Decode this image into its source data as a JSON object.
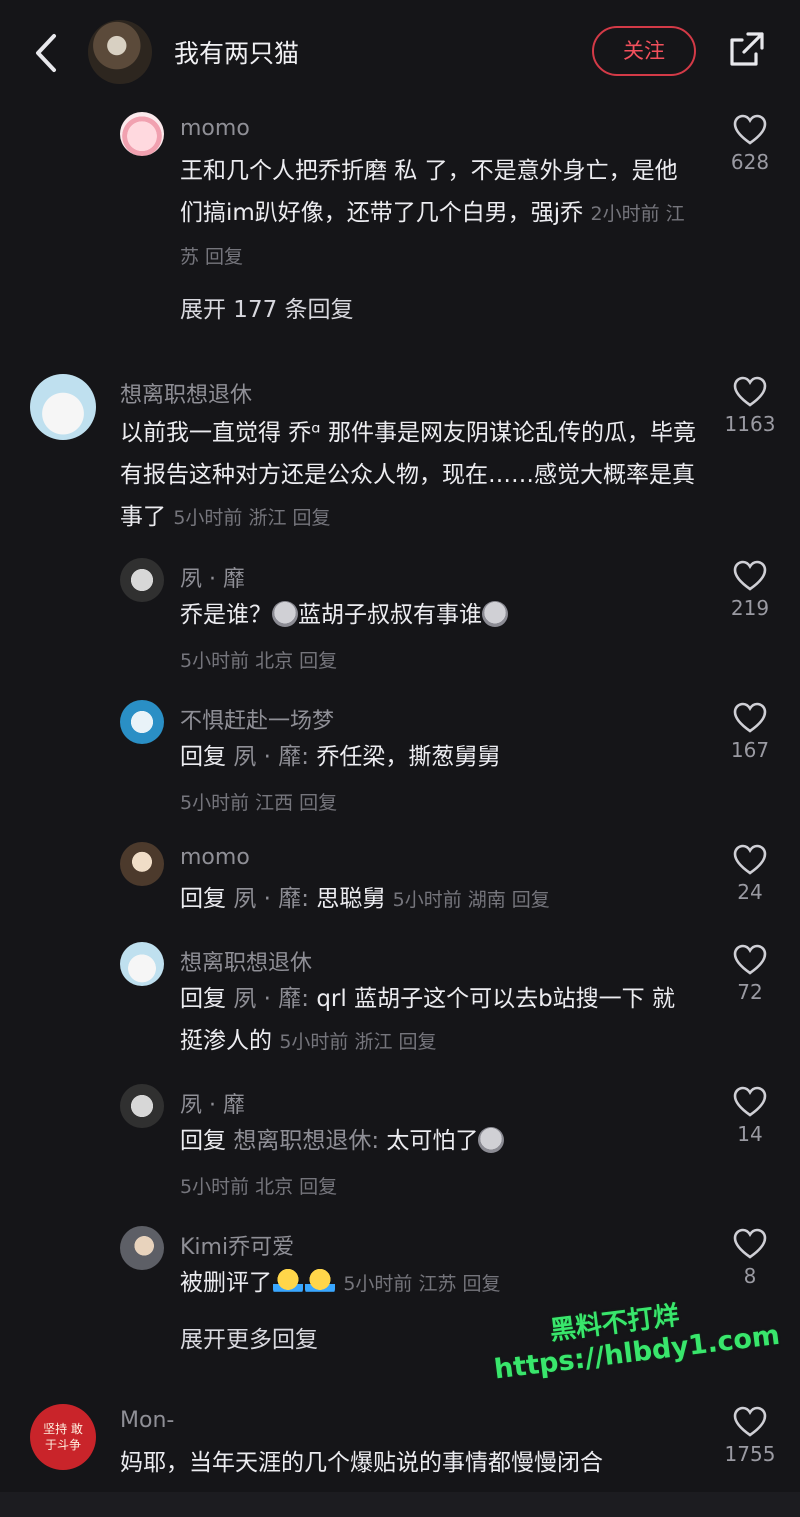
{
  "header": {
    "title": "我有两只猫",
    "follow_label": "关注"
  },
  "comments": [
    {
      "name": "momo",
      "text": "王和几个人把乔折磨 私 了，不是意外身亡，是他们搞im趴好像，还带了几个白男，强j乔",
      "meta": "2小时前 江苏 回复",
      "likes": "628",
      "expand": "展开 177 条回复"
    },
    {
      "name": "想离职想退休",
      "text": "以前我一直觉得 乔ᵅ 那件事是网友阴谋论乱传的瓜，毕竟有报告这种对方还是公众人物，现在……感觉大概率是真事了",
      "meta": "5小时前 浙江 回复",
      "likes": "1163"
    }
  ],
  "replies": [
    {
      "name": "夙 · 靡",
      "text_a": "乔是谁？",
      "text_b": "蓝胡子叔叔有事谁",
      "meta": "5小时前 北京 回复",
      "likes": "219"
    },
    {
      "name": "不惧赶赴一场梦",
      "reply_prefix": "回复",
      "reply_to": "夙 · 靡:",
      "text": "乔任梁，撕葱舅舅",
      "meta": "5小时前 江西 回复",
      "likes": "167"
    },
    {
      "name": "momo",
      "reply_prefix": "回复",
      "reply_to": "夙 · 靡:",
      "text": "思聪舅",
      "meta": "5小时前 湖南 回复",
      "likes": "24"
    },
    {
      "name": "想离职想退休",
      "reply_prefix": "回复",
      "reply_to": "夙 · 靡:",
      "text": "qrl 蓝胡子这个可以去b站搜一下 就挺渗人的",
      "meta": "5小时前 浙江 回复",
      "likes": "72"
    },
    {
      "name": "夙 · 靡",
      "reply_prefix": "回复",
      "reply_to": "想离职想退休:",
      "text": "太可怕了",
      "meta": "5小时前 北京 回复",
      "likes": "14"
    },
    {
      "name": "Kimi乔可爱",
      "text": "被删评了",
      "meta": "5小时前 江苏 回复",
      "likes": "8"
    }
  ],
  "expand_more": "展开更多回复",
  "last_comment": {
    "name": "Mon-",
    "avatar_text": "坚持 敢于斗争",
    "text": "妈耶，当年天涯的几个爆贴说的事情都慢慢闭合",
    "likes": "1755"
  },
  "watermark": {
    "line1": "黑料不打烊",
    "line2": "https://hlbdy1.com"
  },
  "colors": {
    "accent": "#f2505c",
    "background": "#151518",
    "watermark": "#39e66c"
  }
}
